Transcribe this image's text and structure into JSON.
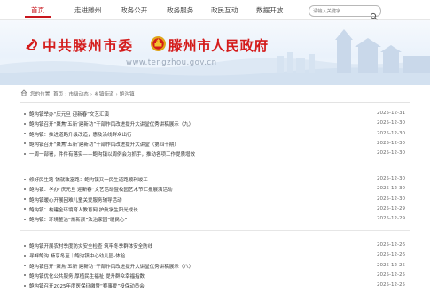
{
  "nav": {
    "items": [
      {
        "label": "首页"
      },
      {
        "label": "走进滕州"
      },
      {
        "label": "政务公开"
      },
      {
        "label": "政务服务"
      },
      {
        "label": "政民互动"
      },
      {
        "label": "数据开放"
      }
    ],
    "search_placeholder": "请输入关键字"
  },
  "banner": {
    "party_title": "中共滕州市委",
    "gov_title": "滕州市人民政府",
    "url": "www.tengzhou.gov.cn"
  },
  "breadcrumb": {
    "prefix": "您的位置:",
    "items": [
      "首页",
      "市级动态",
      "乡镇街道",
      "鲍沟镇"
    ]
  },
  "groups": [
    {
      "items": [
        {
          "title": "鲍沟镇举办“庆元旦 迎新春”文艺汇演",
          "date": "2025-12-31"
        },
        {
          "title": "鲍沟镇召开“聚焦‘五新’建新功”干部作风改进提升大讲堂优秀讲稿展示（九）",
          "date": "2025-12-30"
        },
        {
          "title": "鲍沟镇：推进道路升级改造，惠及沿线群众出行",
          "date": "2025-12-30"
        },
        {
          "title": "鲍沟镇召开“聚焦‘五新’建新功”干部作风改进提升大讲堂（第四十期）",
          "date": "2025-12-30"
        },
        {
          "title": "一周一部署，件件有落实——鲍沟镇以周例会为抓手，推动各项工作提质增效",
          "date": "2025-12-30"
        }
      ]
    },
    {
      "items": [
        {
          "title": "修好民生路 铺就致富路：鲍沟镇又一民生道路顺利竣工",
          "date": "2025-12-30"
        },
        {
          "title": "鲍沟镇：学办“庆元旦 迎新春”文艺活动暨校园艺术节汇报展演活动",
          "date": "2025-12-30"
        },
        {
          "title": "鲍沟镇暖心开展困难儿童关爱服务辅导活动",
          "date": "2025-12-30"
        },
        {
          "title": "鲍沟镇：构建全环境育人教育网 护航学生阳光成长",
          "date": "2025-12-29"
        },
        {
          "title": "鲍沟镇：环境整治“焕新颜”法治家园“暖民心”",
          "date": "2025-12-29"
        }
      ]
    },
    {
      "items": [
        {
          "title": "鲍沟镇开展农村季度防灾安全检查 筑牢冬季群体安全防线",
          "date": "2025-12-26"
        },
        {
          "title": "寻衅鲍沟 畅享冬至｜鲍沟镇中心幼儿园-体验",
          "date": "2025-12-26"
        },
        {
          "title": "鲍沟镇召开“聚焦‘五新’建新功”干部作风改进提升大讲堂优秀讲稿展示（八）",
          "date": "2025-12-25"
        },
        {
          "title": "鲍沟镇优化公共服务 厚植民生福祉 提升群众幸福指数",
          "date": "2025-12-25"
        },
        {
          "title": "鲍沟镇召开2025年度医保征缴暨“赛事爱”投保动员会",
          "date": "2025-12-25"
        }
      ]
    }
  ]
}
